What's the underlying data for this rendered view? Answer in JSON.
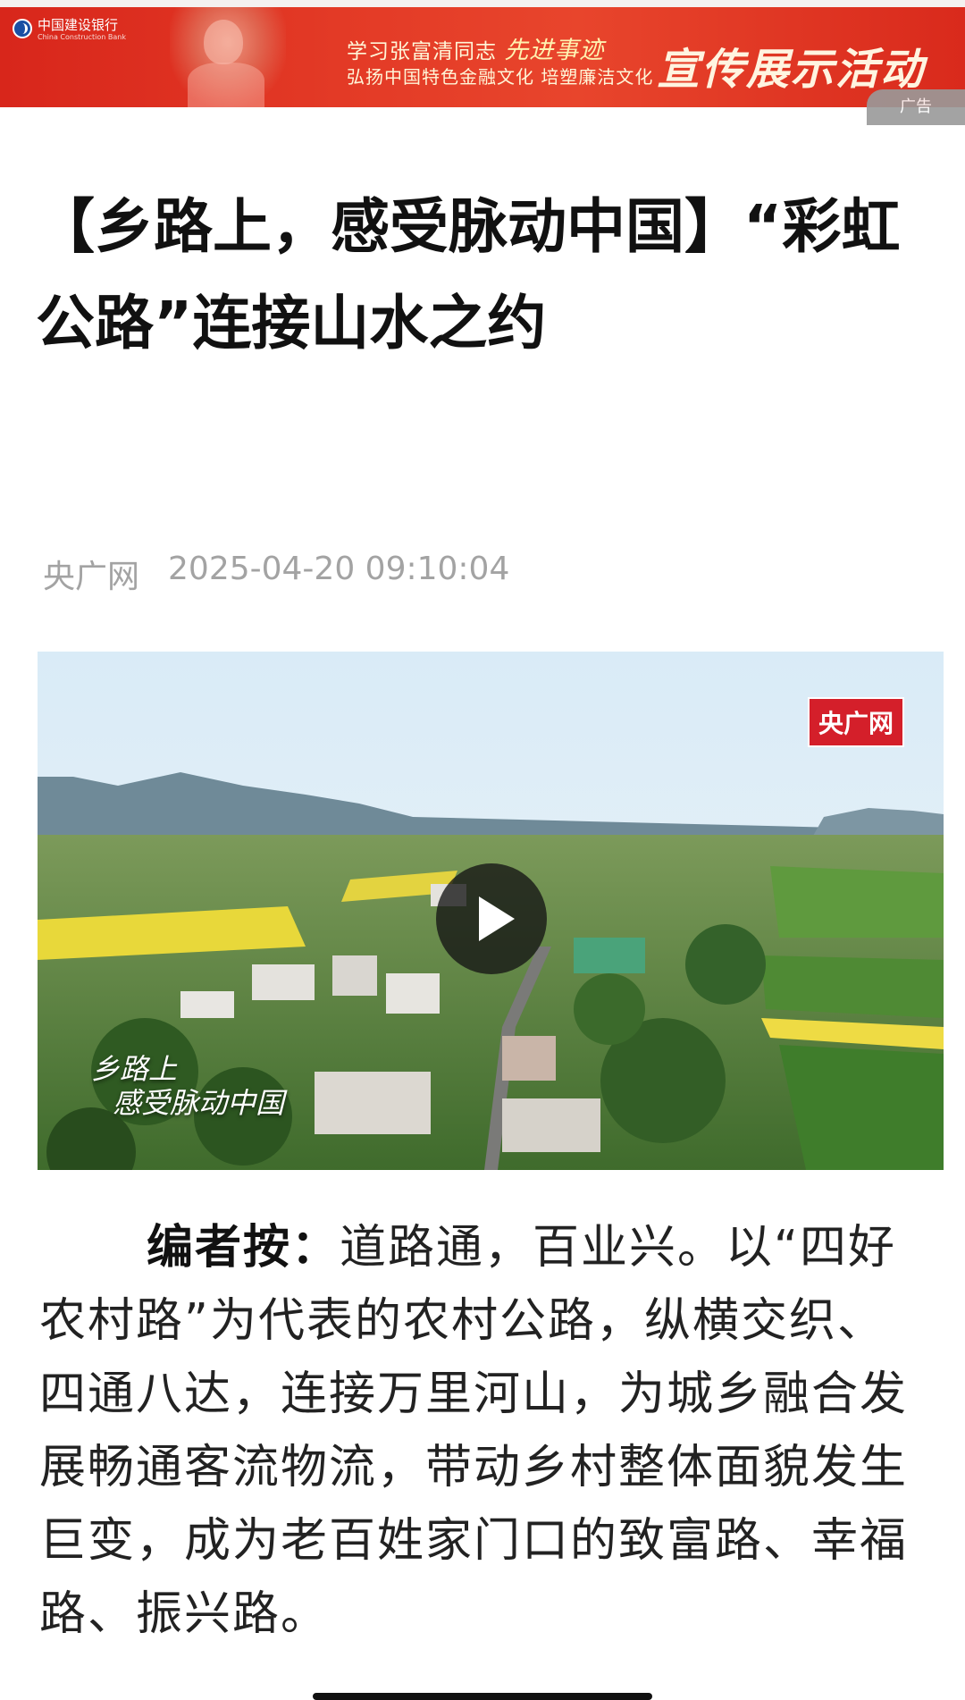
{
  "ad": {
    "bank_name": "中国建设银行",
    "bank_sub": "China Construction Bank",
    "line1_prefix": "学习张富清同志",
    "line1_highlight": "先进事迹",
    "line2": "弘扬中国特色金融文化 培塑廉洁文化",
    "big_text": "宣传展示活动",
    "tag": "广告",
    "color": "#e33a26"
  },
  "article": {
    "title": "【乡路上，感受脉动中国】“彩虹公路”连接山水之约",
    "source": "央广网",
    "datetime": "2025-04-20 09:10:04"
  },
  "video": {
    "badge": "央广网",
    "caption_line1": "乡路上",
    "caption_line2": "感受脉动中国",
    "badge_color": "#d41f2a"
  },
  "body": {
    "lead": "编者按：",
    "text": "道路通，百业兴。以“四好农村路”为代表的农村公路，纵横交织、四通八达，连接万里河山，为城乡融合发展畅通客流物流，带动乡村整体面貌发生巨变，成为老百姓家门口的致富路、幸福路、振兴路。"
  }
}
